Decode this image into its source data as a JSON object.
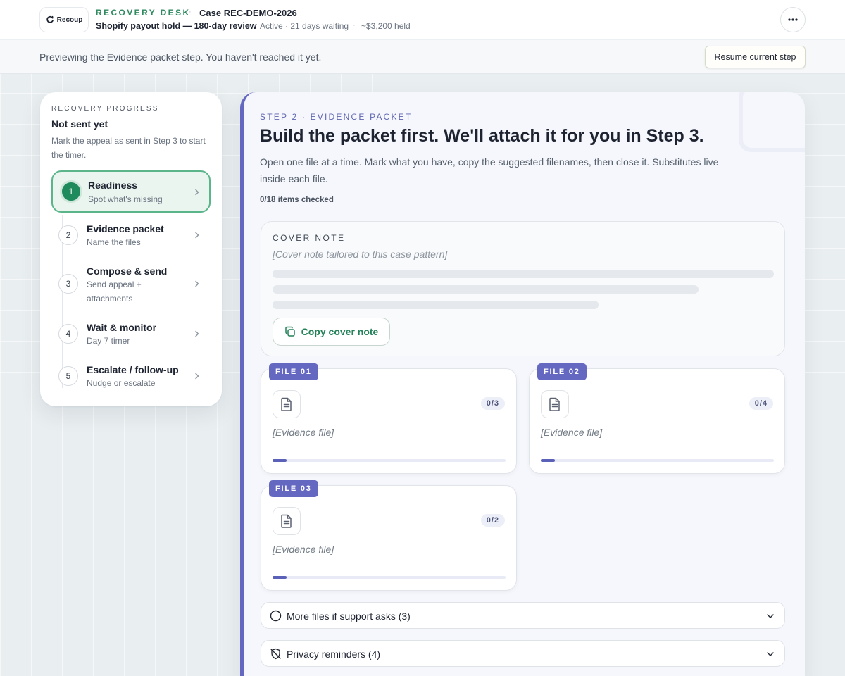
{
  "header": {
    "logo_text": "Recoup",
    "desk_name": "RECOVERY DESK",
    "case_id": "Case REC-DEMO-2026",
    "case_title": "Shopify payout hold — 180-day review",
    "case_status": "Active · 21 days waiting",
    "case_held": "~$3,200 held",
    "more_icon": "more-horizontal-icon"
  },
  "banner": {
    "text": "Previewing the Evidence packet step. You haven't reached it yet.",
    "resume_label": "Resume current step"
  },
  "progress": {
    "eyebrow": "RECOVERY PROGRESS",
    "title": "Not sent yet",
    "description": "Mark the appeal as sent in Step 3 to start the timer.",
    "active_step": 1,
    "steps": [
      {
        "number": "1",
        "title": "Readiness",
        "subtitle": "Spot what's missing"
      },
      {
        "number": "2",
        "title": "Evidence packet",
        "subtitle": "Name the files"
      },
      {
        "number": "3",
        "title": "Compose & send",
        "subtitle": "Send appeal + attachments"
      },
      {
        "number": "4",
        "title": "Wait & monitor",
        "subtitle": "Day 7 timer"
      },
      {
        "number": "5",
        "title": "Escalate / follow-up",
        "subtitle": "Nudge or escalate"
      }
    ]
  },
  "main": {
    "eyebrow": "STEP 2 · EVIDENCE PACKET",
    "headline": "Build the packet first. We'll attach it for you in Step 3.",
    "lede": "Open one file at a time. Mark what you have, copy the suggested filenames, then close it. Substitutes live inside each file.",
    "checked_count": "0/18 items checked",
    "accent_color": "#6468c0",
    "cover": {
      "label": "COVER NOTE",
      "placeholder": "[Cover note tailored to this case pattern]",
      "copy_label": "Copy cover note"
    },
    "files": [
      {
        "tag": "FILE 01",
        "count": "0/3",
        "name": "[Evidence file]",
        "progress": 0.06
      },
      {
        "tag": "FILE 02",
        "count": "0/4",
        "name": "[Evidence file]",
        "progress": 0.06
      },
      {
        "tag": "FILE 03",
        "count": "0/2",
        "name": "[Evidence file]",
        "progress": 0.06
      }
    ],
    "accordions": [
      {
        "label": "More files if support asks (3)",
        "icon": "circle-icon"
      },
      {
        "label": "Privacy reminders (4)",
        "icon": "shield-off-icon"
      }
    ]
  }
}
